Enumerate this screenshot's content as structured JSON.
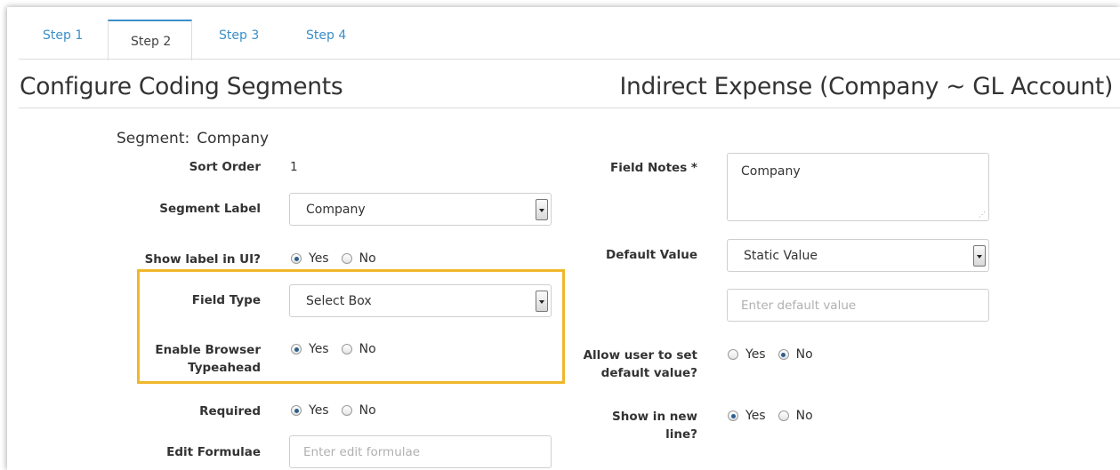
{
  "tabs": [
    {
      "label": "Step 1",
      "active": false
    },
    {
      "label": "Step 2",
      "active": true
    },
    {
      "label": "Step 3",
      "active": false
    },
    {
      "label": "Step 4",
      "active": false
    }
  ],
  "header": {
    "title": "Configure Coding Segments",
    "subtitle": "Indirect Expense (Company ~ GL Account)"
  },
  "segment": {
    "label": "Segment:",
    "value": "Company"
  },
  "left": {
    "sort_order": {
      "label": "Sort Order",
      "value": "1"
    },
    "segment_label": {
      "label": "Segment Label",
      "value": "Company"
    },
    "show_label": {
      "label": "Show label in UI?",
      "yes": "Yes",
      "no": "No",
      "selected": "Yes"
    },
    "field_type": {
      "label": "Field Type",
      "value": "Select Box"
    },
    "typeahead": {
      "label_line1": "Enable Browser",
      "label_line2": "Typeahead",
      "yes": "Yes",
      "no": "No",
      "selected": "Yes"
    },
    "required": {
      "label": "Required",
      "yes": "Yes",
      "no": "No",
      "selected": "Yes"
    },
    "edit_formulae": {
      "label": "Edit Formulae",
      "placeholder": "Enter edit formulae"
    }
  },
  "right": {
    "field_notes": {
      "label": "Field Notes *",
      "value": "Company"
    },
    "default_value": {
      "label": "Default Value",
      "value": "Static Value",
      "input_placeholder": "Enter default value"
    },
    "allow_default": {
      "label_line1": "Allow user to set",
      "label_line2": "default value?",
      "yes": "Yes",
      "no": "No",
      "selected": "No"
    },
    "new_line": {
      "label_line1": "Show in new",
      "label_line2": "line?",
      "yes": "Yes",
      "no": "No",
      "selected": "Yes"
    }
  },
  "colors": {
    "accent": "#3a8fc9",
    "highlight": "#f0b72b"
  }
}
